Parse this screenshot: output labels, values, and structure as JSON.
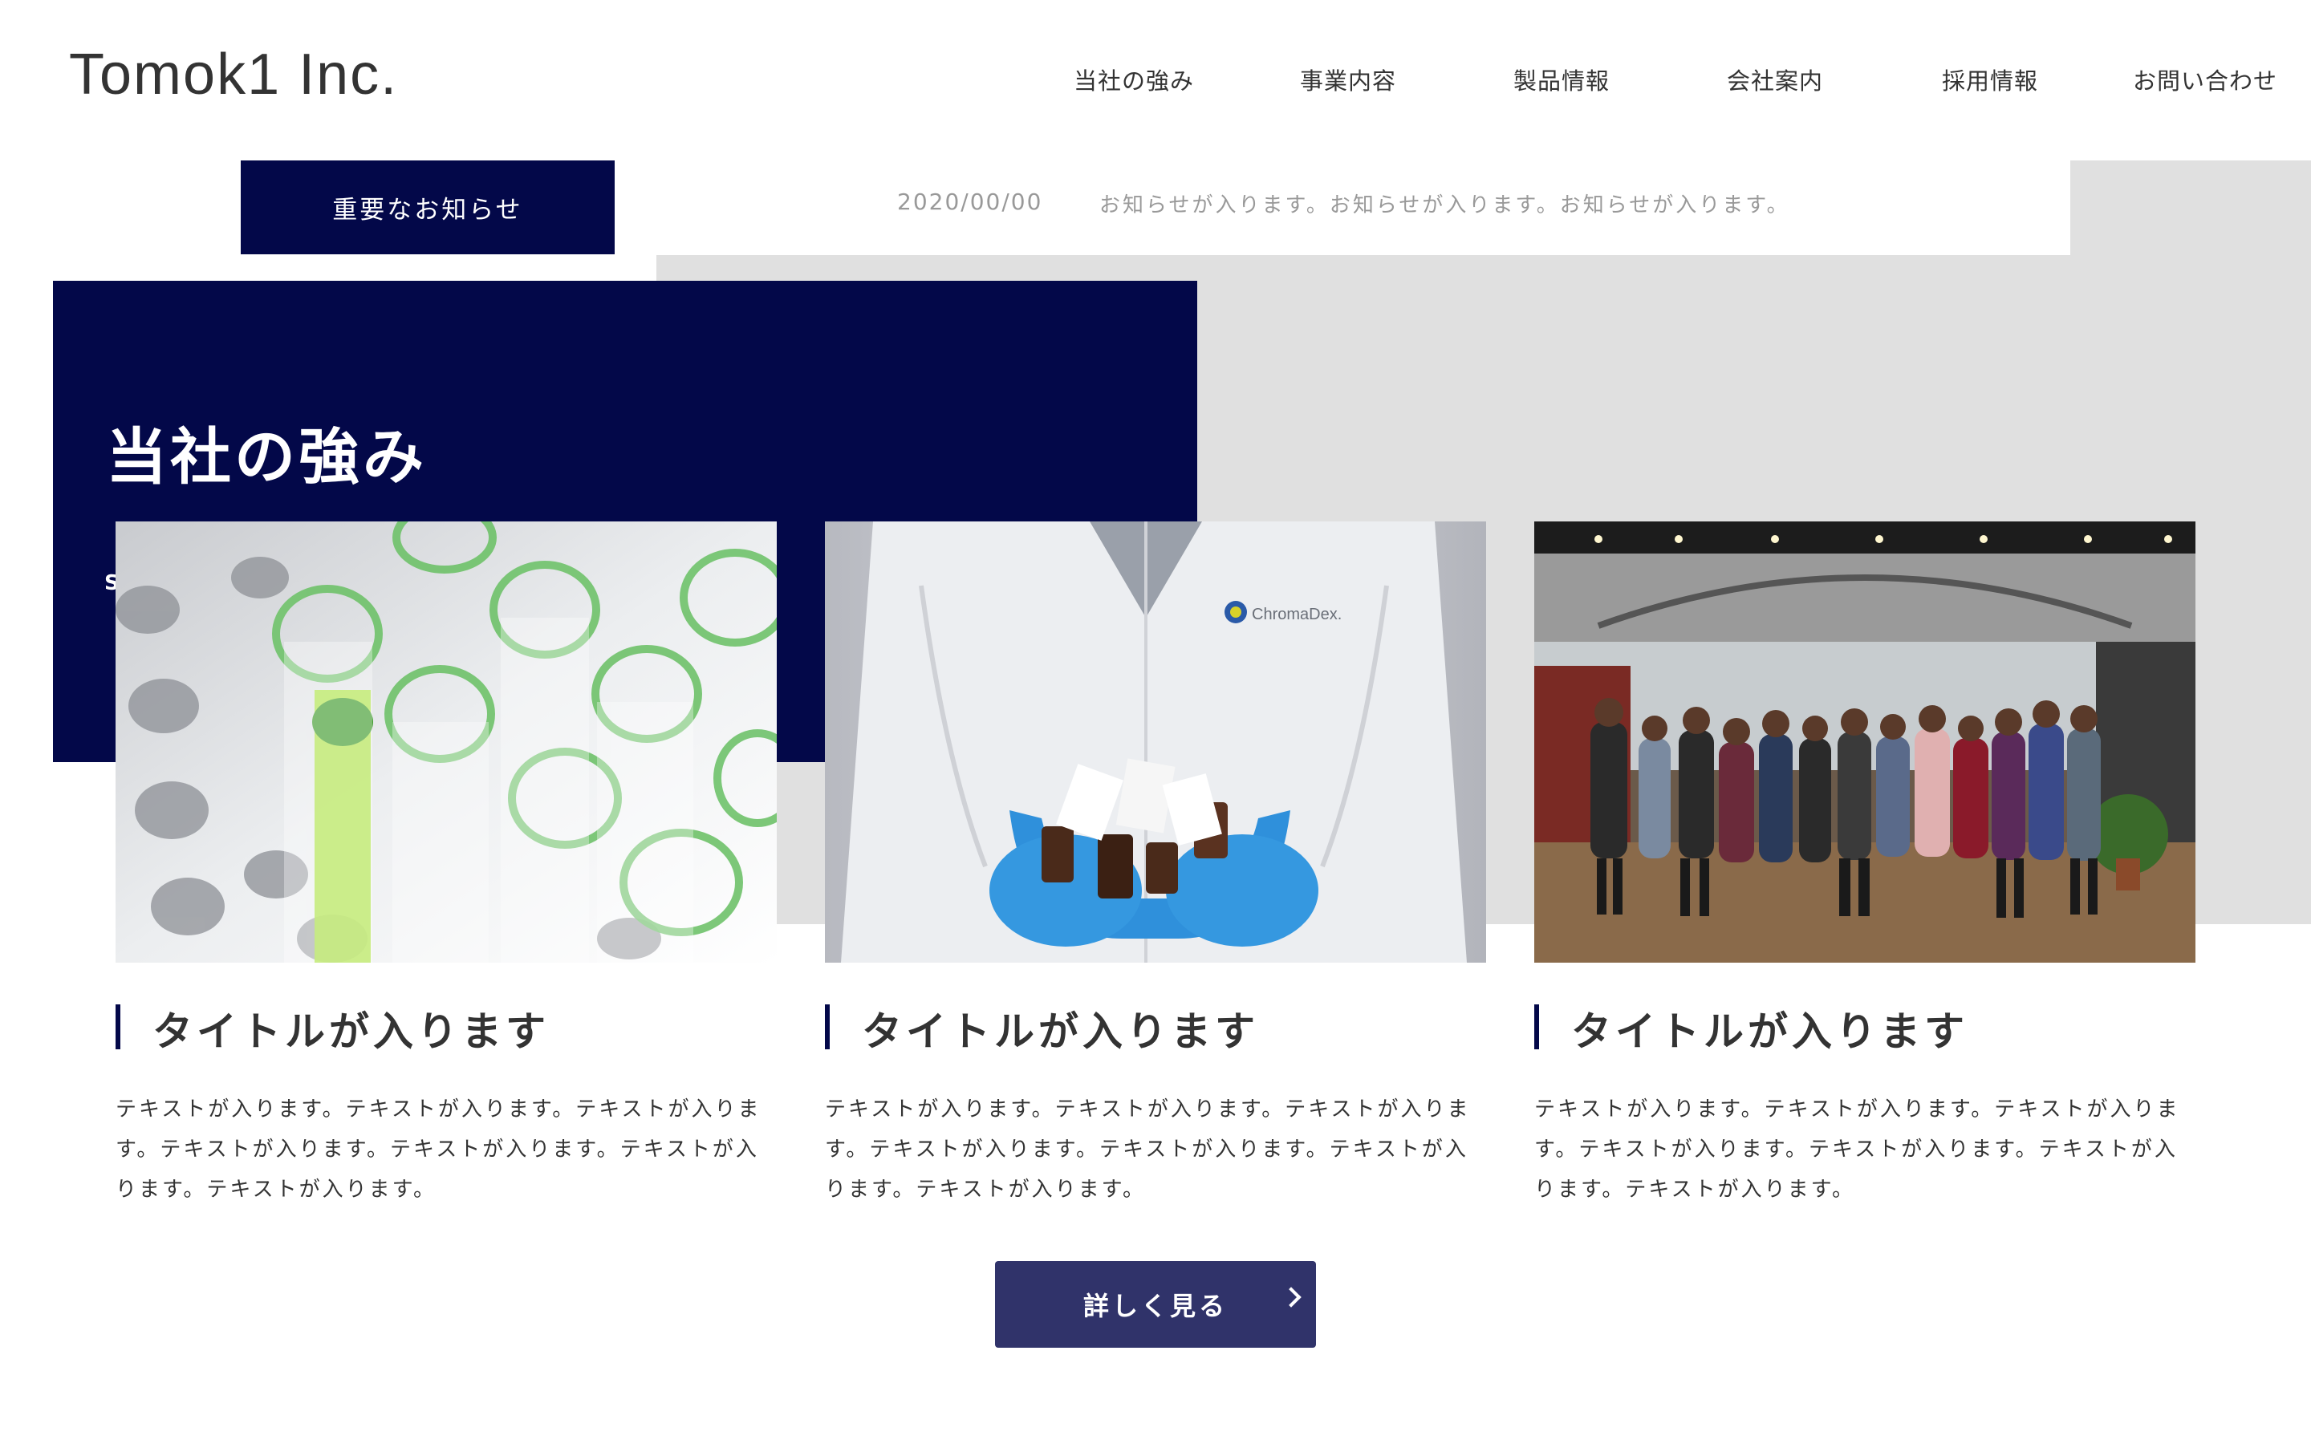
{
  "header": {
    "logo": "Tomok1 Inc.",
    "nav": [
      "当社の強み",
      "事業内容",
      "製品情報",
      "会社案内",
      "採用情報",
      "お問い合わせ"
    ]
  },
  "notice": {
    "label": "重要なお知らせ",
    "date": "2020/00/00",
    "text": "お知らせが入ります。お知らせが入ります。お知らせが入ります。"
  },
  "strengths": {
    "title": "当社の強み",
    "subtitle": "S",
    "cards": [
      {
        "image": "test-tubes-photo",
        "title": "タイトルが入ります",
        "text": "テキストが入ります。テキストが入ります。テキストが入ります。テキストが入ります。テキストが入ります。テキストが入ります。テキストが入ります。"
      },
      {
        "image": "lab-coat-bottles-photo",
        "title": "タイトルが入ります",
        "text": "テキストが入ります。テキストが入ります。テキストが入ります。テキストが入ります。テキストが入ります。テキストが入ります。テキストが入ります。"
      },
      {
        "image": "team-office-photo",
        "title": "タイトルが入ります",
        "text": "テキストが入ります。テキストが入ります。テキストが入ります。テキストが入ります。テキストが入ります。テキストが入ります。テキストが入ります。"
      }
    ],
    "photo_brand": "ChromaDex.",
    "more_button": "詳しく見る"
  },
  "colors": {
    "navy": "#030849",
    "button": "#30336a",
    "grey_band": "#e0e0e0"
  }
}
